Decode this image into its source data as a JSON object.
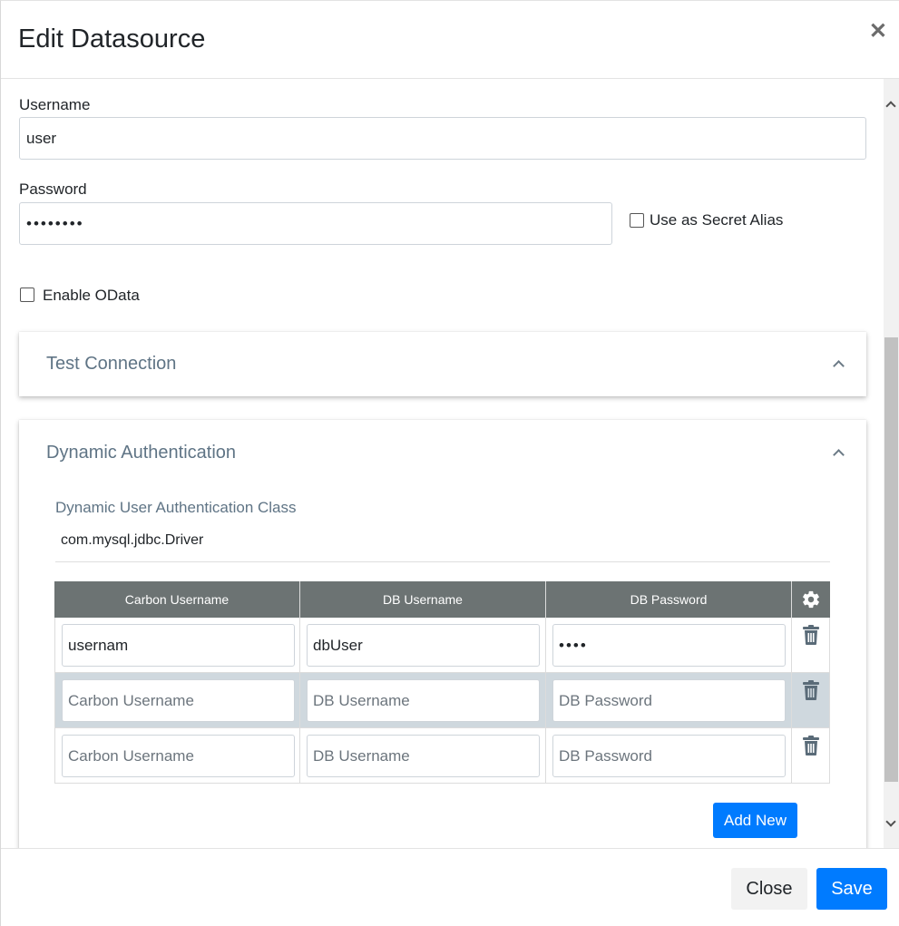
{
  "modal": {
    "title": "Edit Datasource",
    "close_icon": "close-icon"
  },
  "form": {
    "username": {
      "label": "Username",
      "value": "user"
    },
    "password": {
      "label": "Password",
      "value": "••••••••",
      "masked_length": 8
    },
    "secret_alias": {
      "label": "Use as Secret Alias",
      "checked": false
    },
    "enable_odata": {
      "label": "Enable OData",
      "checked": false
    }
  },
  "panels": {
    "test_connection": {
      "title": "Test Connection",
      "expanded": true
    },
    "dynamic_auth": {
      "title": "Dynamic Authentication",
      "expanded": true,
      "class_label": "Dynamic User Authentication Class",
      "class_value": "com.mysql.jdbc.Driver"
    }
  },
  "table": {
    "columns": [
      "Carbon Username",
      "DB Username",
      "DB Password"
    ],
    "settings_icon": "gear-icon",
    "rows": [
      {
        "carbon_username": "usernam",
        "db_username": "dbUser",
        "db_password": "••••",
        "highlighted": false
      },
      {
        "carbon_username": "",
        "db_username": "",
        "db_password": "",
        "highlighted": true
      },
      {
        "carbon_username": "",
        "db_username": "",
        "db_password": "",
        "highlighted": false
      }
    ],
    "placeholders": {
      "carbon_username": "Carbon Username",
      "db_username": "DB Username",
      "db_password": "DB Password"
    },
    "delete_icon": "trash-icon",
    "add_new_label": "Add New"
  },
  "footer": {
    "close_label": "Close",
    "save_label": "Save"
  },
  "colors": {
    "primary": "#007bff",
    "table_header": "#6c7373",
    "panel_title": "#5f7485",
    "highlight_row": "#cfd8de"
  }
}
